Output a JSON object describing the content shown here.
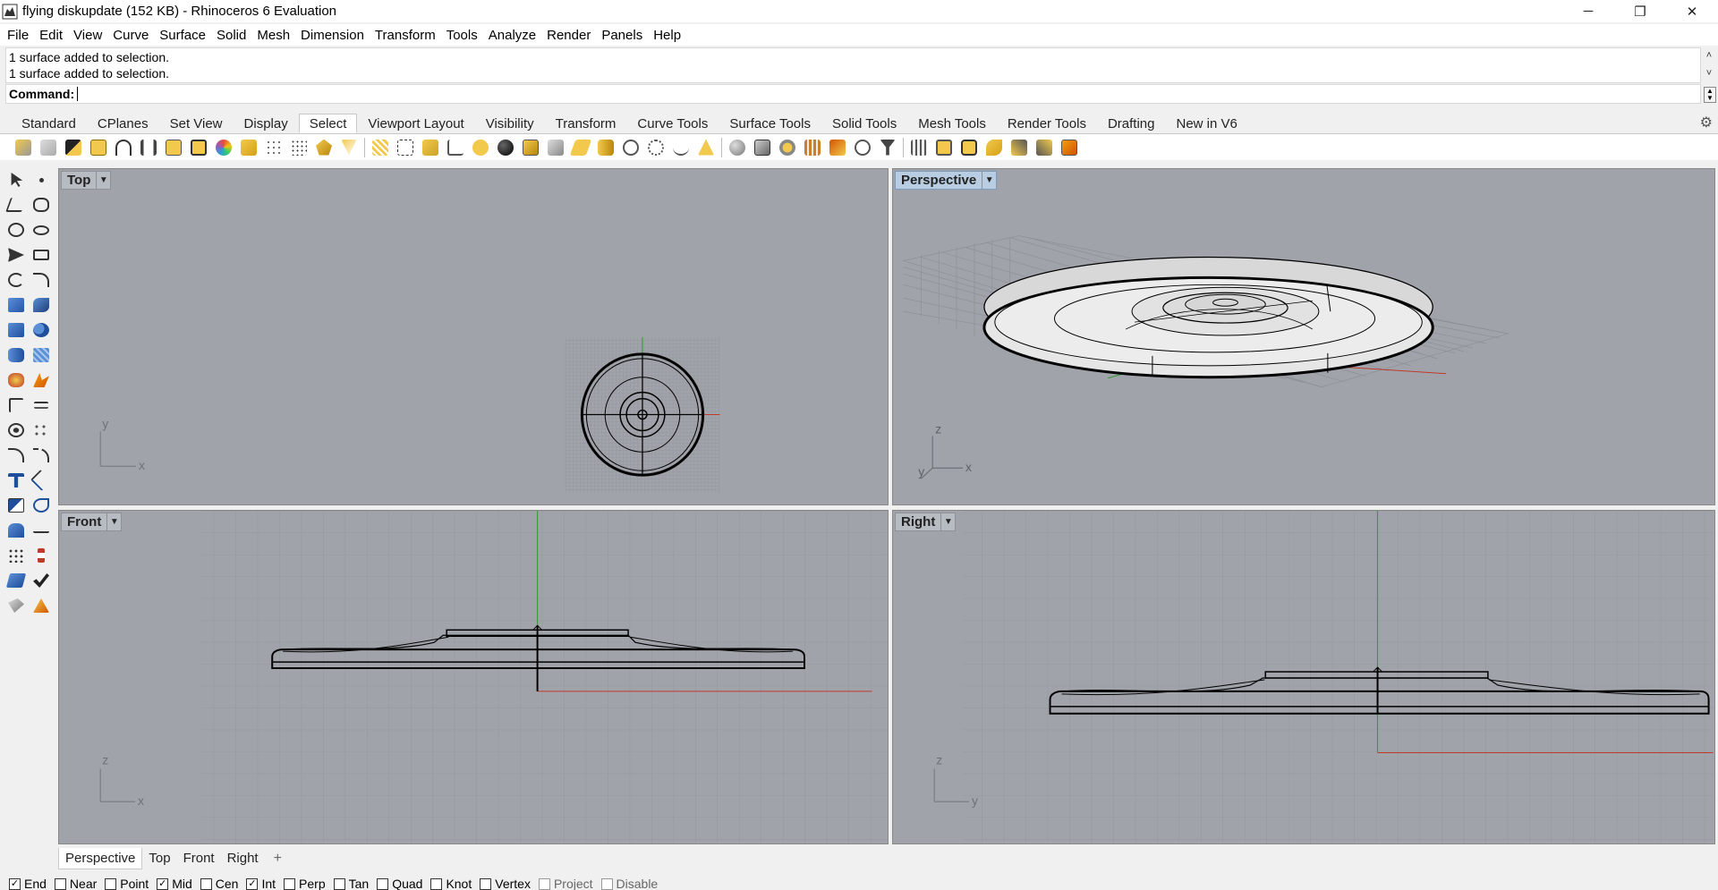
{
  "window": {
    "title": "flying diskupdate (152 KB) - Rhinoceros 6 Evaluation",
    "minimize": "─",
    "restore": "❐",
    "close": "✕"
  },
  "menu": [
    "File",
    "Edit",
    "View",
    "Curve",
    "Surface",
    "Solid",
    "Mesh",
    "Dimension",
    "Transform",
    "Tools",
    "Analyze",
    "Render",
    "Panels",
    "Help"
  ],
  "history": [
    "1 surface added to selection.",
    "1 surface added to selection."
  ],
  "command": {
    "label": "Command:",
    "value": ""
  },
  "toolbar_tabs": [
    "Standard",
    "CPlanes",
    "Set View",
    "Display",
    "Select",
    "Viewport Layout",
    "Visibility",
    "Transform",
    "Curve Tools",
    "Surface Tools",
    "Solid Tools",
    "Mesh Tools",
    "Render Tools",
    "Drafting",
    "New in V6"
  ],
  "active_toolbar_tab": "Select",
  "viewports": {
    "top": {
      "label": "Top",
      "axis_h": "x",
      "axis_v": "y"
    },
    "perspective": {
      "label": "Perspective",
      "axis_h": "x",
      "axis_v": "z",
      "axis_d": "y"
    },
    "front": {
      "label": "Front",
      "axis_h": "x",
      "axis_v": "z"
    },
    "right": {
      "label": "Right",
      "axis_h": "y",
      "axis_v": "z"
    }
  },
  "viewport_tabs": [
    "Perspective",
    "Top",
    "Front",
    "Right"
  ],
  "viewport_tab_add": "+",
  "osnaps": [
    {
      "label": "End",
      "checked": true
    },
    {
      "label": "Near",
      "checked": false
    },
    {
      "label": "Point",
      "checked": false
    },
    {
      "label": "Mid",
      "checked": true
    },
    {
      "label": "Cen",
      "checked": false
    },
    {
      "label": "Int",
      "checked": true
    },
    {
      "label": "Perp",
      "checked": false
    },
    {
      "label": "Tan",
      "checked": false
    },
    {
      "label": "Quad",
      "checked": false
    },
    {
      "label": "Knot",
      "checked": false
    },
    {
      "label": "Vertex",
      "checked": false
    },
    {
      "label": "Project",
      "checked": false,
      "disabled": true
    },
    {
      "label": "Disable",
      "checked": false,
      "disabled": true
    }
  ],
  "colors": {
    "viewport_bg": "#a0a4aa",
    "grid": "#92969c",
    "x_axis": "#c0392b",
    "y_axis": "#2e9b2e",
    "geometry": "#000000"
  }
}
